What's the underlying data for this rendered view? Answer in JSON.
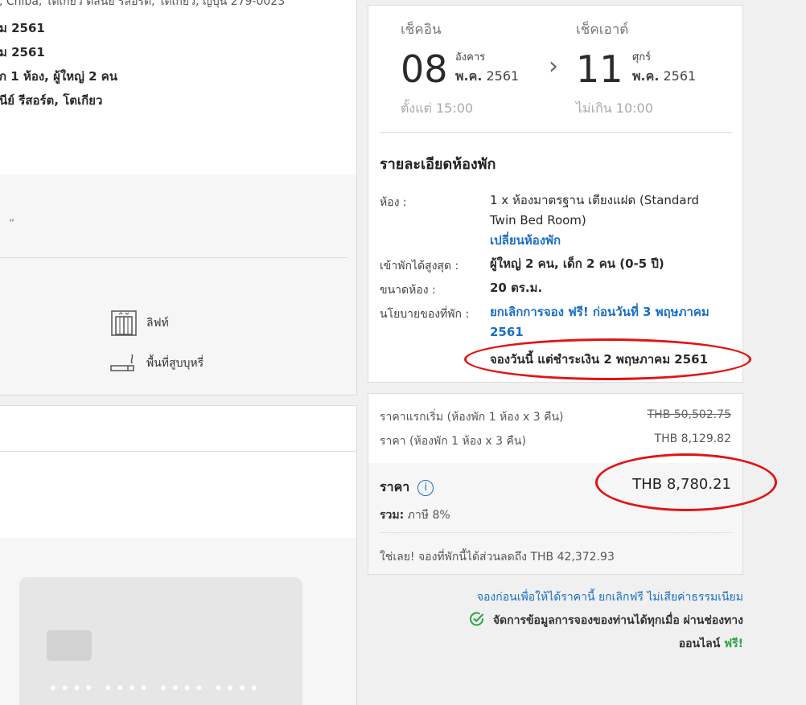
{
  "left": {
    "address": "่, Chiba, โตเกียว ดิสนีย์ รีสอร์ต, โตเกียว, ญี่ปุ่น 279-0023",
    "summary": [
      "ม 2561",
      "ม 2561",
      "ัก 1 ห้อง, ผู้ใหญ่ 2 คน",
      "นีย์ รีสอร์ต, โตเกียว"
    ],
    "quote": "”",
    "amenities": [
      {
        "icon": "elevator-icon",
        "label": "ลิฟท์"
      },
      {
        "icon": "smoking-area-icon",
        "label": "พื้นที่สูบบุหรี่"
      }
    ],
    "card_dots": "•••• •••• •••• ••••"
  },
  "checkin": {
    "label": "เช็คอิน",
    "day": "08",
    "weekday": "อังคาร",
    "month_year_prefix": "พ.ค.",
    "year": "2561",
    "time_prefix": "ตั้งแต่",
    "time": "15:00"
  },
  "checkout": {
    "label": "เช็คเอาต์",
    "day": "11",
    "weekday": "ศุกร์",
    "month_year_prefix": "พ.ค.",
    "year": "2561",
    "time_prefix": "ไม่เกิน",
    "time": "10:00"
  },
  "arrow": "›",
  "room_details": {
    "title": "รายละเอียดห้องพัก",
    "room_label": "ห้อง :",
    "room_value": "1 x ห้องมาตรฐาน เตียงแฝด (Standard Twin Bed Room)",
    "change_room": "เปลี่ยนห้องพัก",
    "max_label": "เข้าพักได้สูงสุด :",
    "max_value": "ผู้ใหญ่ 2 คน, เด็ก 2 คน (0-5 ปี)",
    "size_label": "ขนาดห้อง :",
    "size_value": "20 ตร.ม.",
    "policy_label": "นโยบายของที่พัก :",
    "policy_value": "ยกเลิกการจอง ฟรี! ก่อนวันที่ 3 พฤษภาคม 2561",
    "pay_later": "จองวันนี้ แต่ชำระเงิน 2 พฤษภาคม 2561"
  },
  "price": {
    "original_label": "ราคาแรกเริ่ม (ห้องพัก 1 ห้อง x 3 คืน)",
    "original_value": "THB 50,502.75",
    "price_label": "ราคา (ห้องพัก 1 ห้อง x 3 คืน)",
    "price_value": "THB 8,129.82",
    "total_label": "ราคา",
    "info_icon": "i",
    "total_value": "THB 8,780.21",
    "tax_prefix": "รวม:",
    "tax_text": "ภาษี 8%",
    "saving": "ใช่เลย! จองที่พักนี้ได้ส่วนลดถึง THB 42,372.93"
  },
  "notes": {
    "book_early": "จองก่อนเพื่อให้ได้ราคานี้ ยกเลิกฟรี ไม่เสียค่าธรรมเนียม",
    "manage_line1": "จัดการข้อมูลการจองของท่านได้ทุกเมื่อ ผ่านช่องทาง",
    "manage_line2": "ออนไลน์",
    "free": "ฟรี!"
  },
  "colors": {
    "link": "#1a6fc4",
    "green": "#2aa549",
    "annotation_red": "#e21313"
  }
}
